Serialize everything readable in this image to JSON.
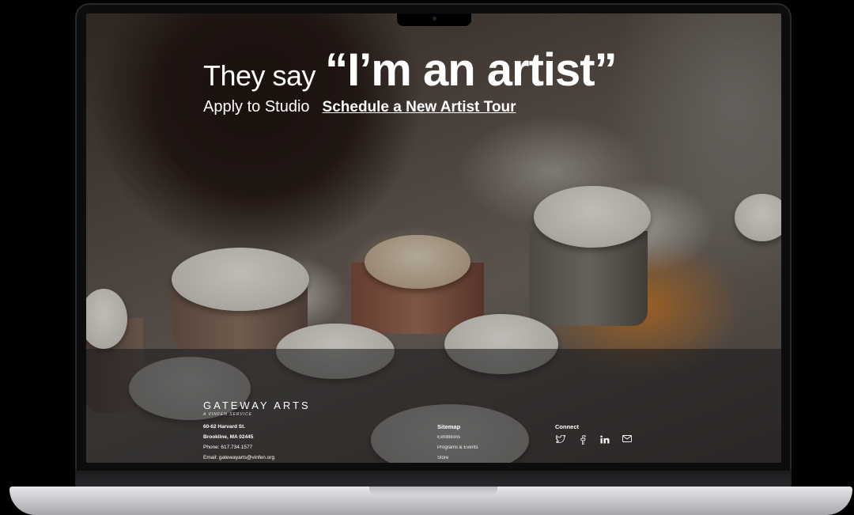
{
  "hero": {
    "lead": "They say",
    "quote": "“I’m an artist”",
    "apply_link": "Apply to Studio",
    "tour_link": "Schedule a New Artist Tour"
  },
  "footer": {
    "brand_name": "GATEWAY ARTS",
    "brand_sub": "A VINFEN SERVICE",
    "address_line1": "60-62 Harvard St.",
    "address_line2": "Brookline, MA 02445",
    "phone": "Phone: 617.734.1577",
    "email": "Email: gatewayarts@vinfen.org",
    "sitemap_title": "Sitemap",
    "sitemap_items": [
      "Exhibitions",
      "Programs & Events",
      "Store"
    ],
    "connect_title": "Connect",
    "social_icons": [
      "twitter-icon",
      "facebook-icon",
      "linkedin-icon",
      "email-icon"
    ]
  }
}
